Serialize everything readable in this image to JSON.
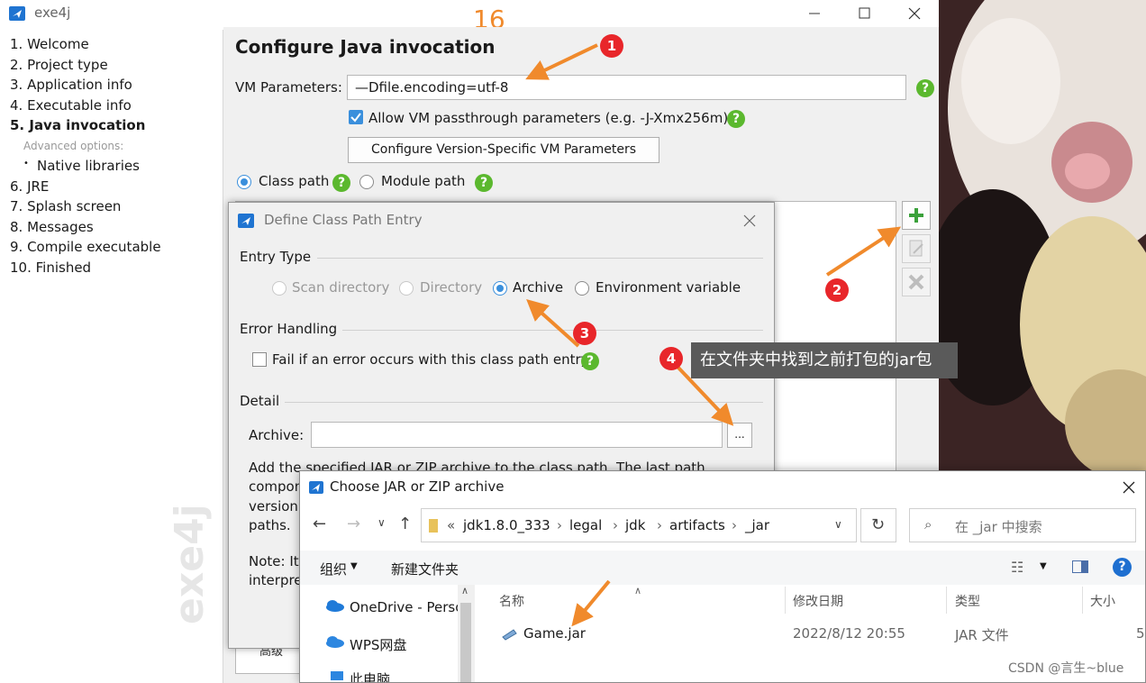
{
  "window": {
    "title": "exe4j",
    "step_number": "16"
  },
  "sidebar": {
    "items": [
      "1. Welcome",
      "2. Project type",
      "3. Application info",
      "4. Executable info",
      "5. Java invocation"
    ],
    "advanced_label": "Advanced options:",
    "sub_item": "Native libraries",
    "items_after": [
      "6. JRE",
      "7. Splash screen",
      "8. Messages",
      "9. Compile executable",
      "10. Finished"
    ],
    "watermark": "exe4j"
  },
  "main": {
    "heading": "Configure Java invocation",
    "vm_label": "VM Parameters:",
    "vm_value": "—Dfile.encoding=utf-8",
    "passthrough_label": "Allow VM passthrough parameters (e.g. -J-Xmx256m)",
    "passthrough_checked": true,
    "version_button": "Configure Version-Specific VM Parameters",
    "classpath_radio": "Class path",
    "modulepath_radio": "Module path",
    "help_glyph": "?",
    "bottom_partial": "高级"
  },
  "dialog": {
    "title": "Define Class Path Entry",
    "entry_type": "Entry Type",
    "entry_options": [
      "Scan directory",
      "Directory",
      "Archive",
      "Environment variable"
    ],
    "selected_option": "Archive",
    "error_handling": "Error Handling",
    "fail_label": "Fail if an error occurs with this class path entry",
    "detail": "Detail",
    "archive_label": "Archive:",
    "archive_value": "",
    "browse_label": "...",
    "desc_line1": "Add the specified JAR or ZIP archive to the class path. The last path",
    "desc_line2": "compon",
    "desc_line3": "version",
    "desc_line4": "paths.",
    "note_line1": "Note: It",
    "note_line2": "interpre"
  },
  "chooser": {
    "title": "Choose JAR or ZIP archive",
    "breadcrumb": [
      "jdk1.8.0_333",
      "legal",
      "jdk",
      "artifacts",
      "_jar"
    ],
    "breadcrumb_prefix": "«",
    "search_placeholder": "在 _jar 中搜索",
    "toolbar_organize": "组织",
    "toolbar_new_folder": "新建文件夹",
    "nav_items": [
      "OneDrive - Perso",
      "WPS网盘",
      "此电脑"
    ],
    "columns": [
      "名称",
      "修改日期",
      "类型",
      "大小"
    ],
    "files": [
      {
        "name": "Game.jar",
        "date": "2022/8/12 20:55",
        "type": "JAR 文件",
        "size": "5"
      }
    ]
  },
  "annotations": {
    "badges": [
      "1",
      "2",
      "3",
      "4"
    ],
    "tooltip": "在文件夹中找到之前打包的jar包",
    "watermark": "CSDN @言生~blue"
  },
  "colors": {
    "accent": "#3a8fdc",
    "help": "#5bb82e",
    "badge": "#e8262a",
    "arrow": "#f08a2c"
  }
}
